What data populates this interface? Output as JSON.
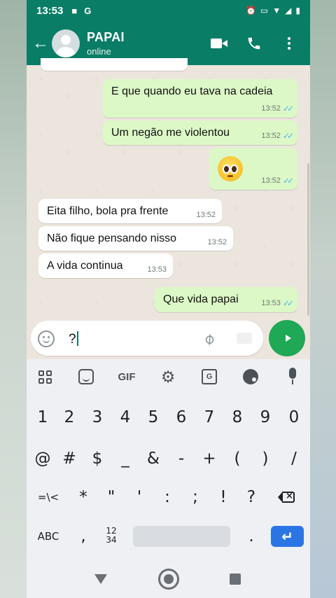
{
  "status_bar": {
    "time": "13:53",
    "carrier_icon": "G"
  },
  "header": {
    "contact_name": "PAPAI",
    "presence": "online"
  },
  "messages": [
    {
      "direction": "out",
      "text": "E que quando eu tava na cadeia",
      "time": "13:52",
      "read": true
    },
    {
      "direction": "out",
      "text": "Um negão me violentou",
      "time": "13:52",
      "read": true
    },
    {
      "direction": "out",
      "emoji": "pleading-face",
      "time": "13:52",
      "read": true
    },
    {
      "direction": "in",
      "text": "Eita filho, bola pra frente",
      "time": "13:52"
    },
    {
      "direction": "in",
      "text": "Não fique pensando nisso",
      "time": "13:52"
    },
    {
      "direction": "in",
      "text": "A vida continua",
      "time": "13:53"
    },
    {
      "direction": "out",
      "text": "Que vida papai",
      "time": "13:53",
      "read": true
    }
  ],
  "composer": {
    "value": "?"
  },
  "keyboard": {
    "toolbar": {
      "gif": "GIF"
    },
    "row_numbers": [
      "1",
      "2",
      "3",
      "4",
      "5",
      "6",
      "7",
      "8",
      "9",
      "0"
    ],
    "row_symbols_1": [
      "@",
      "#",
      "$",
      "_",
      "&",
      "-",
      "+",
      "(",
      ")",
      "/"
    ],
    "row_symbols_2": [
      "=\\<",
      "*",
      "\"",
      "'",
      ":",
      ";",
      "!",
      "?"
    ],
    "bottom": {
      "abc": "ABC",
      "comma": ",",
      "numpad_top": "12",
      "numpad_bottom": "34",
      "period": "."
    }
  },
  "colors": {
    "header": "#0a7d66",
    "outgoing_bubble": "#dcf8c6",
    "incoming_bubble": "#ffffff",
    "send_button": "#1fa855",
    "read_ticks": "#4fb6ec",
    "enter_key": "#2b74e4"
  }
}
